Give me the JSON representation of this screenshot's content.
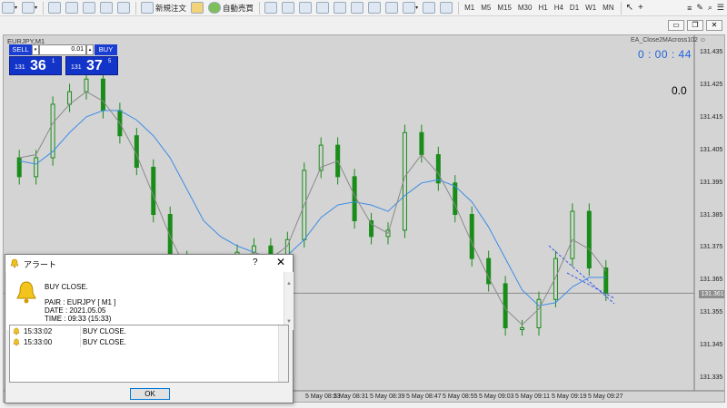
{
  "toolbar": {
    "new_order": "新規注文",
    "auto_trade": "自動売買",
    "timeframes": [
      "M1",
      "M5",
      "M15",
      "M30",
      "H1",
      "H4",
      "D1",
      "W1",
      "MN"
    ]
  },
  "chart": {
    "title": "EURJPY,M1",
    "ea_label": "EA_Close2MAcross102 ☺",
    "timer": "0 : 00 : 44",
    "indicator_value": "0.0",
    "current_price": "131.361",
    "y_ticks": [
      "131.435",
      "131.425",
      "131.415",
      "131.405",
      "131.395",
      "131.385",
      "131.375",
      "131.365",
      "131.355",
      "131.345",
      "131.335"
    ],
    "x_ticks": [
      "5 May 08:23",
      "5 May 08:31",
      "5 May 08:39",
      "5 May 08:47",
      "5 May 08:55",
      "5 May 09:03",
      "5 May 09:11",
      "5 May 09:19",
      "5 May 09:27"
    ],
    "colors": {
      "bull": "#1a8c1a",
      "bear": "#1a8c1a",
      "ma_fast": "#8a8a8a",
      "ma_slow": "#3c8ce6",
      "background": "#d4d4d4"
    }
  },
  "trade_panel": {
    "sell_label": "SELL",
    "buy_label": "BUY",
    "lot": "0.01",
    "sell_prefix": "131",
    "sell_big": "36",
    "sell_sup": "1",
    "buy_prefix": "131",
    "buy_big": "37",
    "buy_sup": "5"
  },
  "dialog": {
    "title": "アラート",
    "help": "?",
    "close": "✕",
    "message": "BUY CLOSE.",
    "pair": "PAIR : EURJPY  [ M1 ]",
    "date": "DATE :  2021.05.05",
    "time": "TIME :  09:33  (15:33)",
    "rows": [
      {
        "time": "15:33:02",
        "msg": "BUY CLOSE."
      },
      {
        "time": "15:33:00",
        "msg": "BUY CLOSE."
      }
    ],
    "ok": "OK"
  },
  "chart_data": {
    "type": "candlestick",
    "symbol": "EURJPY",
    "timeframe": "M1",
    "ylim": [
      131.33,
      131.44
    ],
    "x": [
      "5 May 08:23",
      "5 May 08:31",
      "5 May 08:39",
      "5 May 08:47",
      "5 May 08:55",
      "5 May 09:03",
      "5 May 09:11",
      "5 May 09:19",
      "5 May 09:27"
    ],
    "close": [
      131.398,
      131.404,
      131.421,
      131.425,
      131.429,
      131.419,
      131.411,
      131.401,
      131.386,
      131.372,
      131.366,
      131.355,
      131.371,
      131.374,
      131.376,
      131.369,
      131.378,
      131.4,
      131.408,
      131.398,
      131.384,
      131.379,
      131.381,
      131.412,
      131.405,
      131.396,
      131.386,
      131.372,
      131.364,
      131.35,
      131.35,
      131.359,
      131.372,
      131.387,
      131.369,
      131.361
    ],
    "ma_fast": [
      131.404,
      131.405,
      131.415,
      131.421,
      131.425,
      131.422,
      131.415,
      131.405,
      131.392,
      131.379,
      131.368,
      131.361,
      131.366,
      131.371,
      131.374,
      131.372,
      131.376,
      131.389,
      131.401,
      131.403,
      131.392,
      131.383,
      131.38,
      131.398,
      131.405,
      131.399,
      131.389,
      131.377,
      131.366,
      131.356,
      131.351,
      131.356,
      131.366,
      131.378,
      131.375,
      131.368
    ],
    "ma_slow": [
      131.403,
      131.402,
      131.406,
      131.412,
      131.417,
      131.419,
      131.419,
      131.416,
      131.411,
      131.404,
      131.394,
      131.384,
      131.379,
      131.376,
      131.374,
      131.372,
      131.373,
      131.378,
      131.385,
      131.389,
      131.39,
      131.389,
      131.387,
      131.392,
      131.396,
      131.397,
      131.395,
      131.39,
      131.382,
      131.372,
      131.362,
      131.357,
      131.358,
      131.363,
      131.366,
      131.366
    ],
    "current_price": 131.361
  }
}
